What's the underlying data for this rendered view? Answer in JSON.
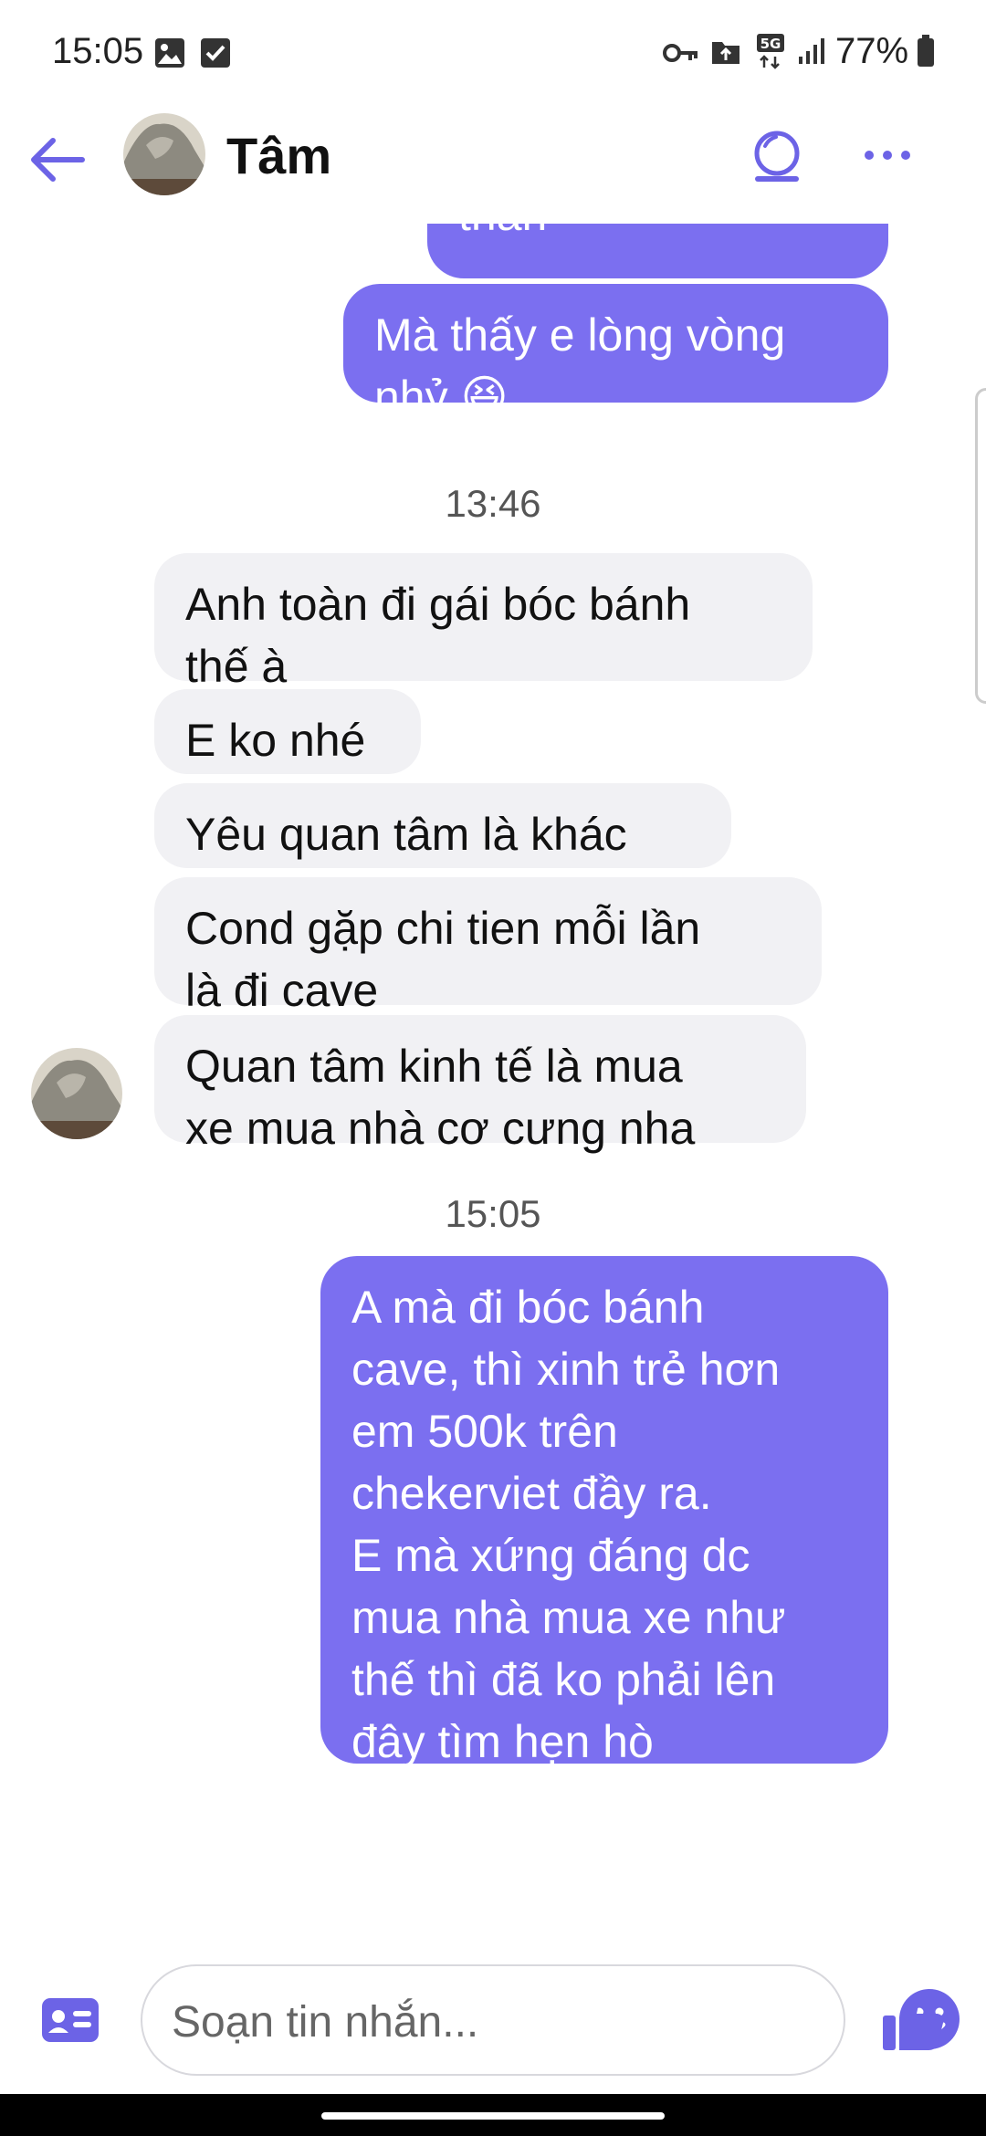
{
  "status_bar": {
    "time": "15:05",
    "battery": "77%",
    "network": "5G"
  },
  "header": {
    "contact_name": "Tâm",
    "accent": "#7b6ff0"
  },
  "messages": [
    {
      "from": "me",
      "text": "thân"
    },
    {
      "from": "me",
      "text": "Mà thấy e lòng vòng\nnhỷ 😆"
    },
    {
      "type": "timestamp",
      "text": "13:46"
    },
    {
      "from": "contact",
      "text": "Anh toàn đi gái bóc bánh\nthế à"
    },
    {
      "from": "contact",
      "text": "E ko nhé"
    },
    {
      "from": "contact",
      "text": "Yêu quan tâm là khác"
    },
    {
      "from": "contact",
      "text": "Cond gặp chi tien mỗi lần\nlà đi cave"
    },
    {
      "from": "contact",
      "text": "Quan tâm kinh tế là mua\nxe mua nhà cơ cưng nha"
    },
    {
      "type": "timestamp",
      "text": "15:05"
    },
    {
      "from": "me",
      "text": "A mà đi bóc bánh\ncave, thì xinh trẻ hơn\nem 500k trên\nchekerviet đầy ra.\nE mà xứng đáng dc\nmua nhà mua xe như\nthế thì đã ko phải lên\nđây tìm hẹn hò"
    }
  ],
  "composer": {
    "placeholder": "Soạn tin nhắn..."
  },
  "colors": {
    "outgoing_bubble": "#7b6ff0",
    "incoming_bubble": "#f1f1f4"
  }
}
